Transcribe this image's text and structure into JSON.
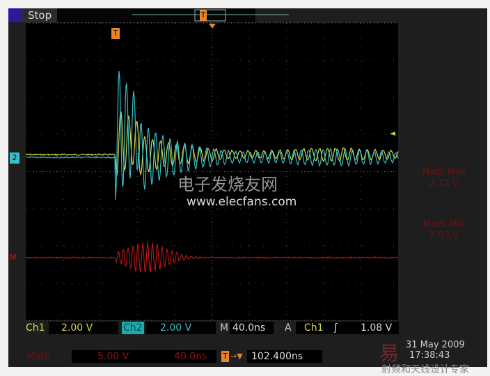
{
  "status": {
    "run_state": "Stop"
  },
  "trigger_marker": "T",
  "channels": {
    "ch1": {
      "label": "Ch1",
      "scale": "2.00 V",
      "color": "#d8d84a",
      "marker": "1"
    },
    "ch2": {
      "label": "Ch2",
      "scale": "2.00 V",
      "color": "#35c0c8",
      "marker": "2"
    },
    "math": {
      "label": "Math",
      "scale": "5.00 V",
      "time": "40.0ns",
      "color": "#c01818",
      "marker": "M"
    }
  },
  "timebase": {
    "prefix": "M",
    "value": "40.0ns"
  },
  "trigger": {
    "prefix": "A",
    "source": "Ch1",
    "slope": "ʃ",
    "level": "1.08 V",
    "position": "102.400ns"
  },
  "measurements": [
    {
      "label": "Math Max",
      "value": "2.72 V"
    },
    {
      "label": "Math Min",
      "value": "2.03 V"
    }
  ],
  "datetime": {
    "date": "31 May 2009",
    "time": "17:38:43"
  },
  "watermark": {
    "cn": "电子发烧友网",
    "url": "www.elecfans.com",
    "footer": "射频和天线设计专家"
  }
}
